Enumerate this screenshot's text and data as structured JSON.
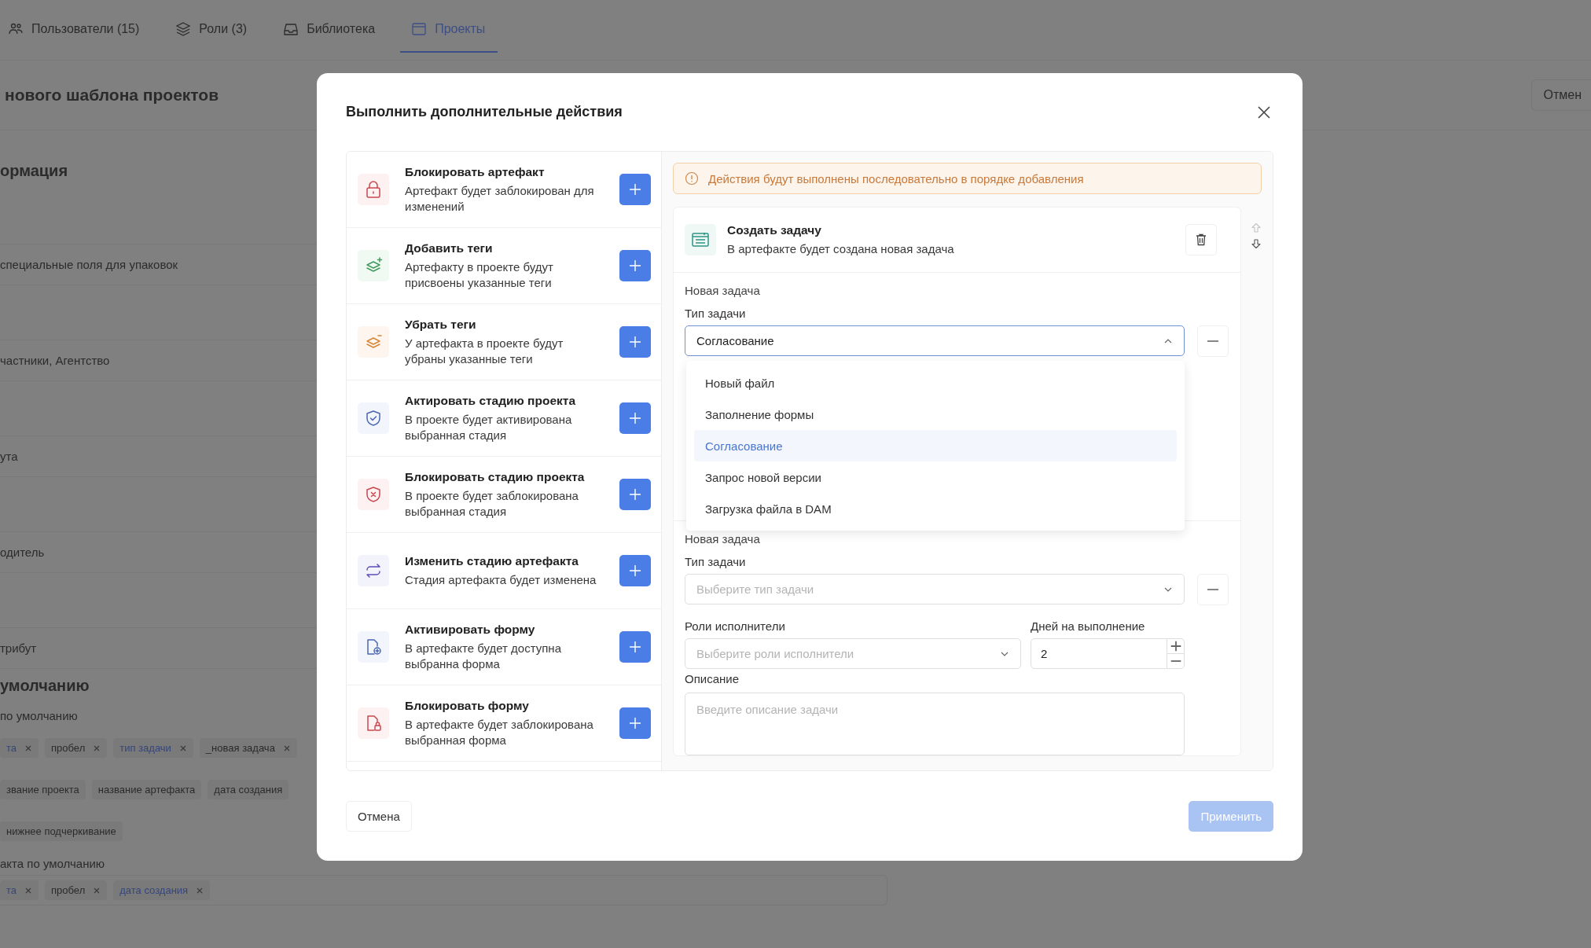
{
  "tabs": [
    {
      "kind": "users",
      "label": "Пользователи (15)",
      "selected": false
    },
    {
      "kind": "layers",
      "label": "Роли (3)",
      "selected": false
    },
    {
      "kind": "inbox",
      "label": "Библиотека",
      "selected": false
    },
    {
      "kind": "window",
      "label": "Проекты",
      "selected": true
    }
  ],
  "page": {
    "title": "нового шаблона проектов",
    "cancel_button": "Отмен",
    "rows": [
      {
        "kind": "heading",
        "text": "ормация"
      },
      {
        "kind": "field",
        "text": "специальные поля для упаковок"
      },
      {
        "kind": "field",
        "text": "частники, Агентство"
      },
      {
        "kind": "field",
        "text": "ута"
      },
      {
        "kind": "field",
        "text": "одитель"
      },
      {
        "kind": "field",
        "text": "трибут"
      },
      {
        "kind": "heading",
        "text": "умолчанию"
      },
      {
        "kind": "label",
        "text": "по умолчанию"
      },
      {
        "kind": "tags",
        "tags": [
          {
            "label": "та",
            "kind": "variable",
            "removable": true
          },
          {
            "label": "пробел",
            "kind": "text",
            "removable": true
          },
          {
            "label": "тип задачи",
            "kind": "variable",
            "removable": true
          },
          {
            "label": "_новая задача",
            "kind": "text",
            "removable": true
          }
        ]
      },
      {
        "kind": "tags",
        "tags": [
          {
            "label": "звание проекта",
            "kind": "text",
            "removable": false
          },
          {
            "label": "название артефакта",
            "kind": "text",
            "removable": false
          },
          {
            "label": "дата создания",
            "kind": "text",
            "removable": false
          }
        ]
      },
      {
        "kind": "tags",
        "tags": [
          {
            "label": "нижнее подчеркивание",
            "kind": "text",
            "removable": false
          }
        ]
      },
      {
        "kind": "label",
        "text": "акта по умолчанию"
      },
      {
        "kind": "tag-field",
        "tags": [
          {
            "label": "та",
            "kind": "variable",
            "removable": true
          },
          {
            "label": "пробел",
            "kind": "text",
            "removable": true
          },
          {
            "label": "дата создания",
            "kind": "variable",
            "removable": true
          }
        ]
      }
    ]
  },
  "modal": {
    "title": "Выполнить дополнительные действия",
    "actions": [
      {
        "kind": "lock",
        "title": "Блокировать артефакт",
        "description": "Артефакт будет заблокирован для изменений"
      },
      {
        "kind": "tags-add",
        "title": "Добавить теги",
        "description": "Артефакту в проекте будут присвоены указанные теги"
      },
      {
        "kind": "tags-remove",
        "title": "Убрать теги",
        "description": "У артефакта в проекте будут убраны указанные теги"
      },
      {
        "kind": "shield-check",
        "title": "Актировать стадию проекта",
        "description": "В проекте будет активирована выбранная стадия"
      },
      {
        "kind": "shield-x",
        "title": "Блокировать стадию проекта",
        "description": "В проекте будет заблокирована выбранная стадия"
      },
      {
        "kind": "swap",
        "title": "Изменить стадию артефакта",
        "description": "Стадия артефакта будет изменена"
      },
      {
        "kind": "form-add",
        "title": "Активировать форму",
        "description": "В артефакте будет доступна выбранна форма"
      },
      {
        "kind": "form-lock",
        "title": "Блокировать форму",
        "description": "В артефакте будет заблокирована выбранная форма"
      }
    ],
    "notice": "Действия будут выполнены последовательно в порядке добавления",
    "step": {
      "title": "Создать задачу",
      "description": "В артефакте будет создана новая задача",
      "tasks": [
        {
          "heading": "Новая задача",
          "type_label": "Тип задачи",
          "type_value": "Согласование",
          "expanded": true,
          "options": [
            {
              "label": "Новый файл",
              "selected": false
            },
            {
              "label": "Заполнение формы",
              "selected": false
            },
            {
              "label": "Согласование",
              "selected": true
            },
            {
              "label": "Запрос новой версии",
              "selected": false
            },
            {
              "label": "Загрузка файла в DAM",
              "selected": false
            }
          ]
        },
        {
          "heading": "Новая задача",
          "type_label": "Тип задачи",
          "type_placeholder": "Выберите тип задачи",
          "expanded": false,
          "roles_label": "Роли исполнители",
          "roles_placeholder": "Выберите роли исполнители",
          "days_label": "Дней на выполнение",
          "days_value": "2",
          "description_label": "Описание",
          "description_placeholder": "Введите описание задачи"
        }
      ]
    },
    "cancel_button": "Отмена",
    "apply_button": {
      "label": "Применить",
      "disabled": true
    }
  }
}
